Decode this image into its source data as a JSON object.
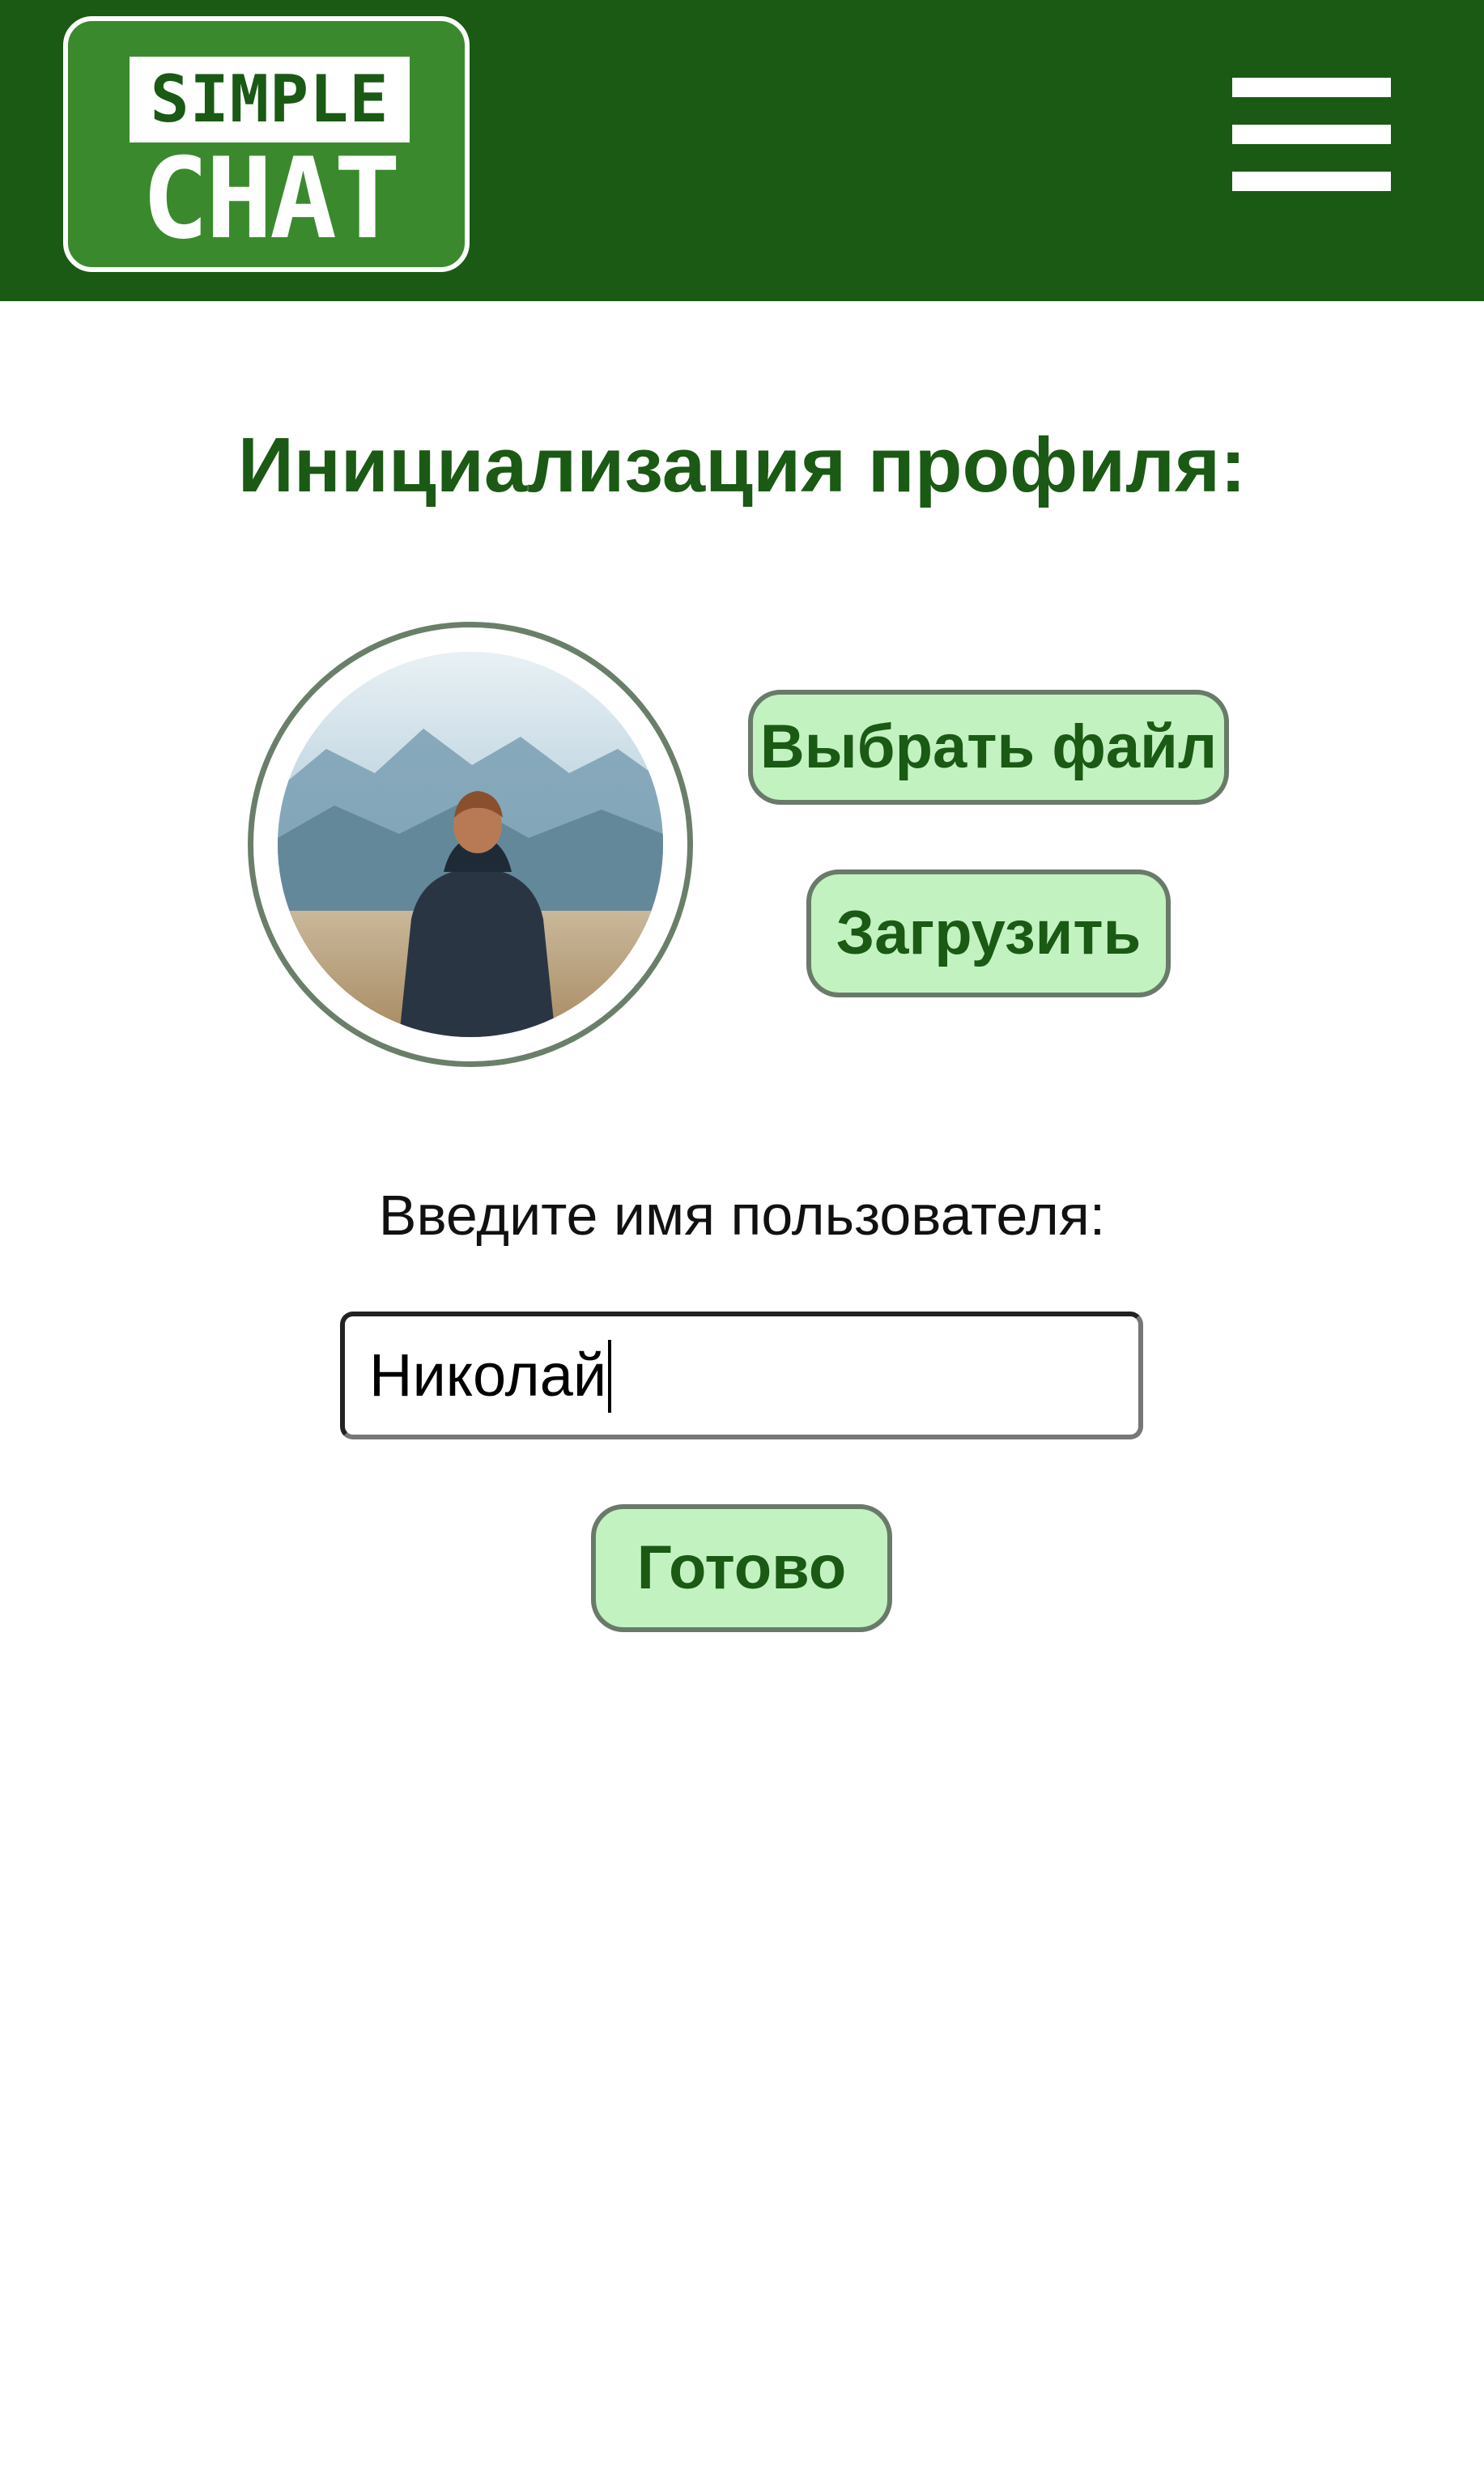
{
  "header": {
    "logo": {
      "line1": "SIMPLE",
      "line2": "CHAT"
    },
    "menu_icon": "hamburger-menu-icon",
    "background_color": "#1a5a14"
  },
  "main": {
    "title": "Инициализация профиля:",
    "avatar": {
      "image": "profile photo: person in dark jacket facing mountains"
    },
    "choose_file_label": "Выбрать файл",
    "upload_label": "Загрузить",
    "username_label": "Введите имя пользователя:",
    "username_value": "Николай",
    "done_label": "Готово"
  },
  "colors": {
    "primary": "#1a5a14",
    "button_fill": "#c3f2c1",
    "button_border": "#6a7a6a"
  }
}
